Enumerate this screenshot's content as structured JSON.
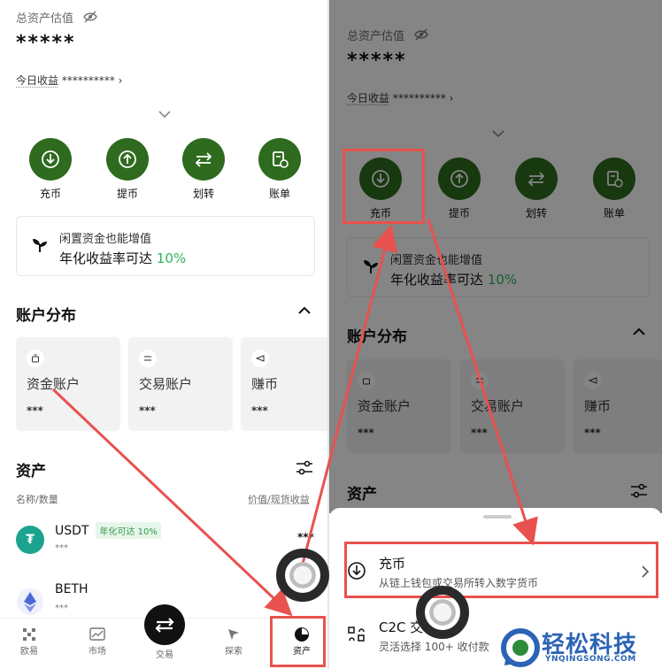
{
  "left": {
    "total_label": "总资产估值",
    "total_value": "*****",
    "pnl_label": "今日收益",
    "pnl_value": "**********",
    "actions": [
      {
        "label": "充币",
        "icon": "deposit-icon"
      },
      {
        "label": "提币",
        "icon": "withdraw-icon"
      },
      {
        "label": "划转",
        "icon": "transfer-icon"
      },
      {
        "label": "账单",
        "icon": "bill-icon"
      }
    ],
    "promo": {
      "line1": "闲置资金也能增值",
      "line2_prefix": "年化收益率可达",
      "line2_rate": "10%"
    },
    "distribution_title": "账户分布",
    "accounts": [
      {
        "name": "资金账户",
        "value": "***"
      },
      {
        "name": "交易账户",
        "value": "***"
      },
      {
        "name": "赚币",
        "value": "***"
      }
    ],
    "assets_title": "资产",
    "col_left": "名称/数量",
    "col_right": "价值/现货收益",
    "coins": [
      {
        "name": "USDT",
        "badge": "年化可达 10%",
        "amount": "***",
        "value": "***"
      },
      {
        "name": "BETH",
        "amount": "***"
      }
    ],
    "tabs": [
      {
        "label": "欧易",
        "icon": "home-icon"
      },
      {
        "label": "市场",
        "icon": "market-icon"
      },
      {
        "label": "交易",
        "icon": "trade-icon"
      },
      {
        "label": "探索",
        "icon": "explore-icon"
      },
      {
        "label": "资产",
        "icon": "assets-icon"
      }
    ]
  },
  "right": {
    "total_label": "总资产估值",
    "total_value": "*****",
    "pnl_label": "今日收益",
    "pnl_value": "**********",
    "actions": [
      {
        "label": "充币"
      },
      {
        "label": "提币"
      },
      {
        "label": "划转"
      },
      {
        "label": "账单"
      }
    ],
    "promo": {
      "line1": "闲置资金也能增值",
      "line2_prefix": "年化收益率可达",
      "line2_rate": "10%"
    },
    "distribution_title": "账户分布",
    "accounts": [
      {
        "name": "资金账户",
        "value": "***"
      },
      {
        "name": "交易账户",
        "value": "***"
      },
      {
        "name": "赚币",
        "value": "***"
      }
    ],
    "assets_title": "资产",
    "sheet": {
      "opt1_title": "充币",
      "opt1_sub": "从链上钱包或交易所转入数字货币",
      "opt2_title": "C2C 交",
      "opt2_sub": "灵活选择 100+ 收付款"
    }
  },
  "watermark": {
    "text": "轻松科技",
    "sub": "YNQINGSONG.COM"
  },
  "colors": {
    "accent_green": "#2e6b1e",
    "highlight_red": "#e8524e",
    "rate_green": "#2fb45a"
  }
}
